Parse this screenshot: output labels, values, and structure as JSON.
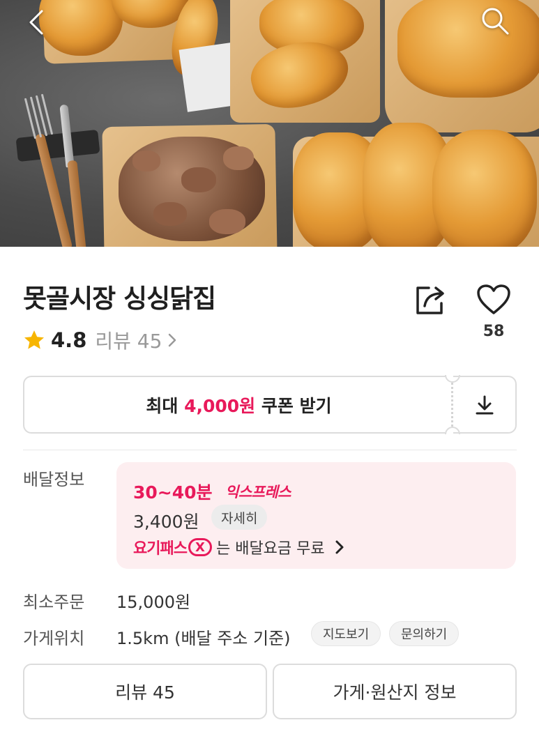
{
  "header": {
    "back_icon": "chevron-left-icon",
    "search_icon": "search-icon"
  },
  "store": {
    "name": "못골시장 싱싱닭집",
    "rating": "4.8",
    "review_link": "리뷰 45",
    "like_count": "58",
    "star_color": "#f7b500"
  },
  "coupon": {
    "prefix": "최대 ",
    "amount": "4,000원",
    "suffix": " 쿠폰 받기",
    "accent_color": "#e8195a"
  },
  "delivery": {
    "label": "배달정보",
    "time": "30~40분",
    "type": "익스프레스",
    "fee": "3,400원",
    "detail_button": "자세히",
    "pass_logo": "요기패스",
    "pass_x": "X",
    "pass_text": "는 배달요금 무료"
  },
  "min_order": {
    "label": "최소주문",
    "value": "15,000원"
  },
  "location": {
    "label": "가게위치",
    "value": "1.5km (배달 주소 기준)",
    "map_button": "지도보기",
    "inquiry_button": "문의하기"
  },
  "bottom_buttons": {
    "review": "리뷰 45",
    "store_info": "가게·원산지 정보"
  }
}
